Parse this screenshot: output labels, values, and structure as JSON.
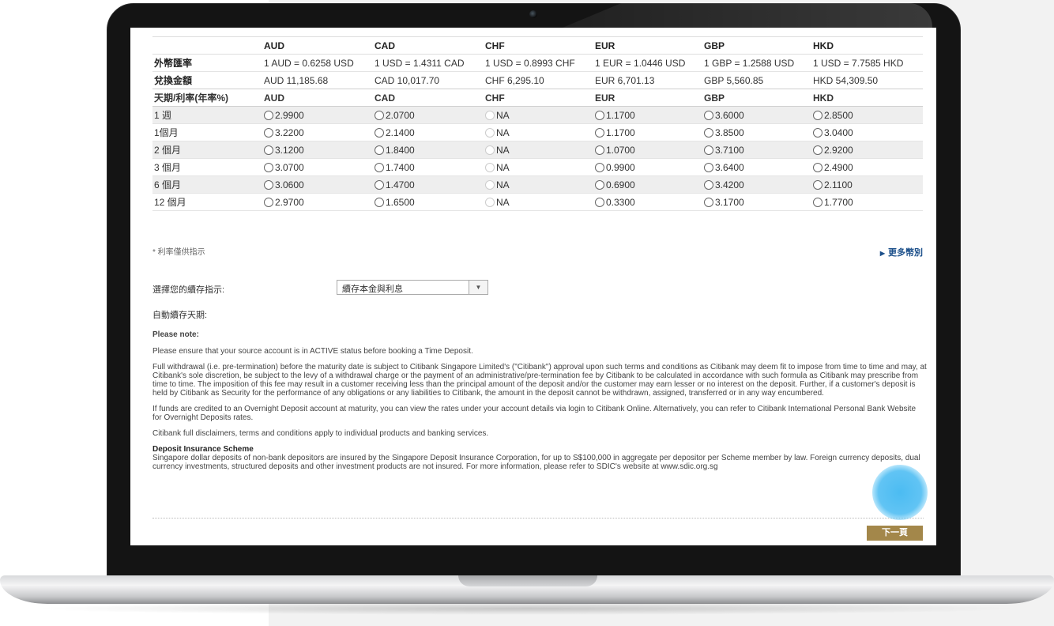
{
  "table": {
    "currencies": [
      "AUD",
      "CAD",
      "CHF",
      "EUR",
      "GBP",
      "HKD"
    ],
    "fx_label": "外幣匯率",
    "fx_rates": [
      "1 AUD = 0.6258 USD",
      "1 USD = 1.4311 CAD",
      "1 USD = 0.8993 CHF",
      "1 EUR = 1.0446 USD",
      "1 GBP = 1.2588 USD",
      "1 USD = 7.7585 HKD"
    ],
    "amount_label": "兌換金額",
    "amounts": [
      "AUD 11,185.68",
      "CAD 10,017.70",
      "CHF 6,295.10",
      "EUR 6,701.13",
      "GBP 5,560.85",
      "HKD 54,309.50"
    ],
    "term_header": "天期/利率(年率%)",
    "terms": [
      {
        "label": "1 週",
        "rates": [
          "2.9900",
          "2.0700",
          "NA",
          "1.1700",
          "3.6000",
          "2.8500"
        ]
      },
      {
        "label": "1個月",
        "rates": [
          "3.2200",
          "2.1400",
          "NA",
          "1.1700",
          "3.8500",
          "3.0400"
        ]
      },
      {
        "label": "2 個月",
        "rates": [
          "3.1200",
          "1.8400",
          "NA",
          "1.0700",
          "3.7100",
          "2.9200"
        ]
      },
      {
        "label": "3 個月",
        "rates": [
          "3.0700",
          "1.7400",
          "NA",
          "0.9900",
          "3.6400",
          "2.4900"
        ]
      },
      {
        "label": "6 個月",
        "rates": [
          "3.0600",
          "1.4700",
          "NA",
          "0.6900",
          "3.4200",
          "2.1100"
        ]
      },
      {
        "label": "12 個月",
        "rates": [
          "2.9700",
          "1.6500",
          "NA",
          "0.3300",
          "3.1700",
          "1.7700"
        ]
      }
    ]
  },
  "footnote": "* 利率僅供指示",
  "more_currencies": "更多幣別",
  "rollover": {
    "label": "選擇您的續存指示:",
    "selected": "續存本金與利息",
    "auto_label": "自動續存天期:"
  },
  "notes": {
    "heading": "Please note:",
    "p1": "Please ensure that your source account is in ACTIVE status before booking a Time Deposit.",
    "p2": "Full withdrawal (i.e. pre-termination) before the maturity date is subject to Citibank Singapore Limited's (\"Citibank\") approval upon such terms and conditions as Citibank may deem fit to impose from time to time and may, at Citibank's sole discretion, be subject to the levy of a withdrawal charge or the payment of an administrative/pre-termination fee by Citibank to be calculated in accordance with such formula as Citibank may prescribe from time to time. The imposition of this fee may result in a customer receiving less than the principal amount of the deposit and/or the customer may earn lesser or no interest on the deposit. Further, if a customer's deposit is held by Citibank as Security for the performance of any obligations or any liabilities to Citibank, the amount in the deposit cannot be withdrawn, assigned, transferred or in any way encumbered.",
    "p3": "If funds are credited to an Overnight Deposit account at maturity, you can view the rates under your account details via login to Citibank Online. Alternatively, you can refer to Citibank International Personal Bank Website for Overnight Deposits rates.",
    "p4": "Citibank full disclaimers, terms and conditions apply to individual products and banking services.",
    "dis_title": "Deposit Insurance Scheme",
    "dis_text": "Singapore dollar deposits of non-bank depositors are insured by the Singapore Deposit Insurance Corporation, for up to S$100,000 in aggregate per depositor per Scheme member by law. Foreign currency deposits, dual currency investments, structured deposits and other investment products are not insured. For more information, please refer to SDIC's website at www.sdic.org.sg"
  },
  "next_button": "下一頁",
  "colors": {
    "next_button": "#a3874a",
    "link": "#1b4f8a",
    "touch_indicator": "#2cb0f0"
  }
}
